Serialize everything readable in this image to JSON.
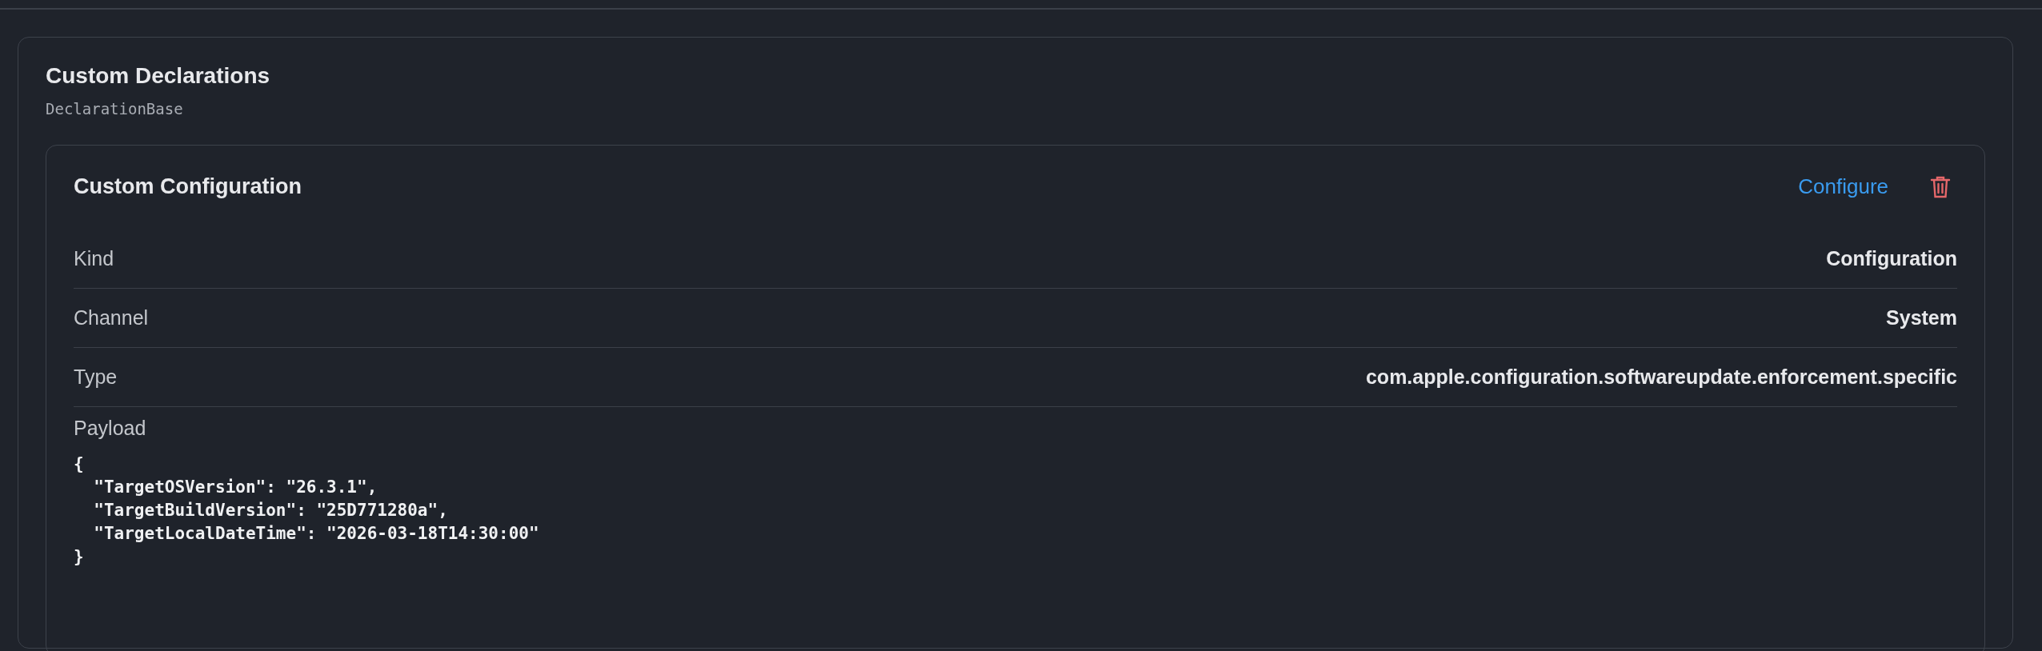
{
  "section": {
    "title": "Custom Declarations",
    "subtitle": "DeclarationBase"
  },
  "card": {
    "title": "Custom Configuration",
    "configure_link": "Configure",
    "properties": [
      {
        "label": "Kind",
        "value": "Configuration"
      },
      {
        "label": "Channel",
        "value": "System"
      },
      {
        "label": "Type",
        "value": "com.apple.configuration.softwareupdate.enforcement.specific"
      }
    ],
    "payload": {
      "label": "Payload",
      "lines": [
        "{",
        "  \"TargetOSVersion\": \"26.3.1\",",
        "  \"TargetBuildVersion\": \"25D771280a\",",
        "  \"TargetLocalDateTime\": \"2026-03-18T14:30:00\"",
        "}"
      ]
    }
  }
}
